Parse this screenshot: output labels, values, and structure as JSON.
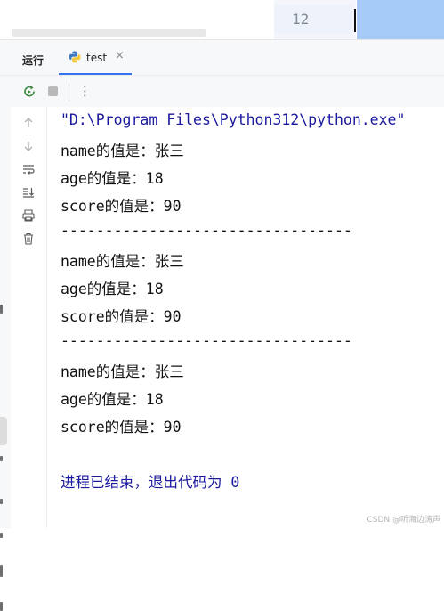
{
  "editor": {
    "line_number": "12"
  },
  "tool_window": {
    "title": "运行",
    "tab_label": "test",
    "tab_close": "×",
    "more_label": "⋮"
  },
  "console": {
    "lines": [
      "\"D:\\Program Files\\Python312\\python.exe\"",
      "name的值是：张三",
      "age的值是：18",
      "score的值是：90",
      "---------------------------------",
      "name的值是：张三",
      "age的值是：18",
      "score的值是：90",
      "---------------------------------",
      "name的值是：张三",
      "age的值是：18",
      "score的值是：90",
      "进程已结束，退出代码为 0"
    ]
  },
  "watermark": "CSDN @听海边涛声",
  "colors": {
    "accent": "#3574f0",
    "console_path": "#1b1a9e",
    "selection": "#a6cbf8"
  },
  "icons": [
    "rerun-icon",
    "stop-icon",
    "more-icon",
    "arrow-up-icon",
    "arrow-down-icon",
    "soft-wrap-icon",
    "scroll-to-end-icon",
    "print-icon",
    "trash-icon",
    "python-icon",
    "close-icon"
  ]
}
